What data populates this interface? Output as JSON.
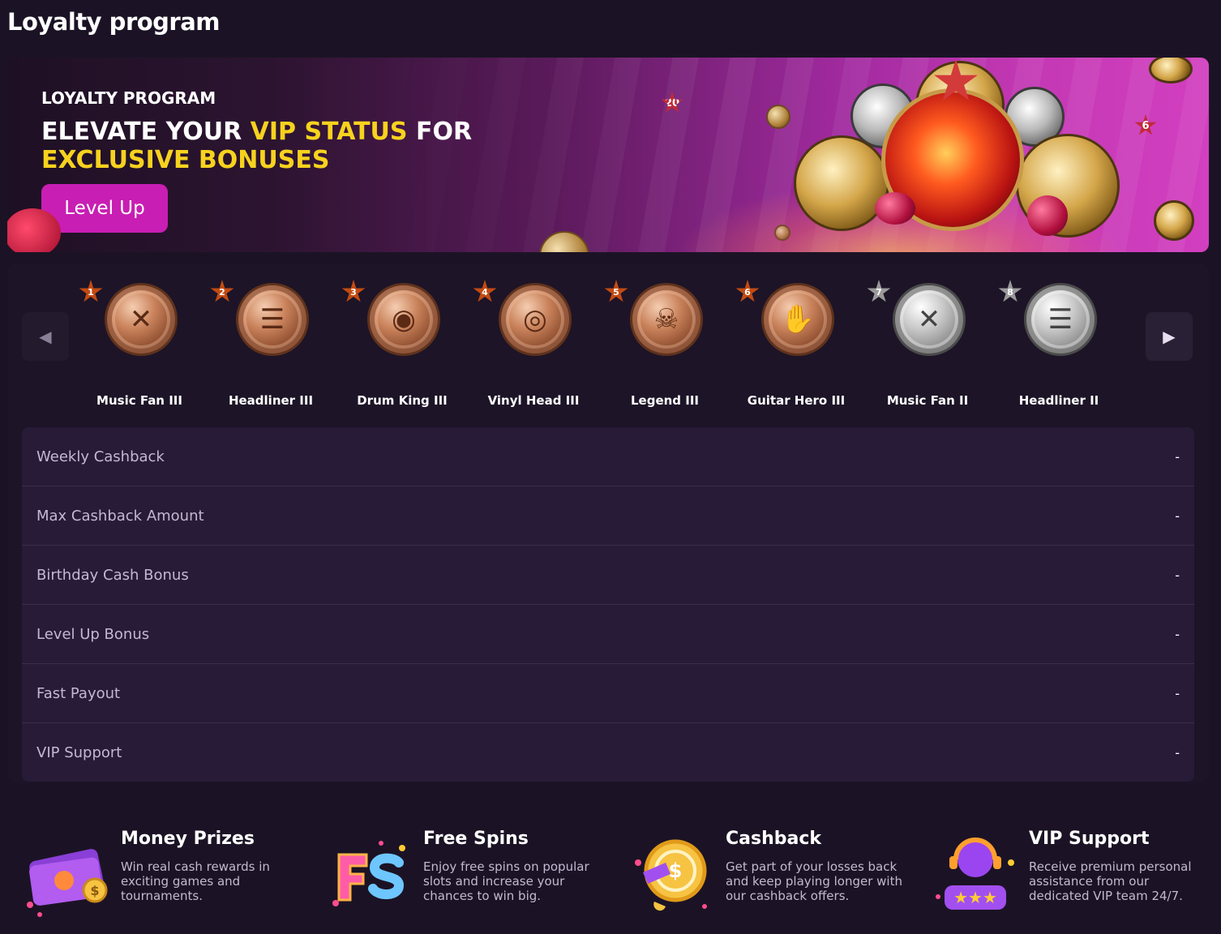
{
  "page": {
    "title": "Loyalty program"
  },
  "hero": {
    "eyebrow": "LOYALTY PROGRAM",
    "headline_part1": "ELEVATE YOUR ",
    "headline_highlight1": "VIP STATUS",
    "headline_part2": " FOR",
    "headline_highlight2": "EXCLUSIVE BONUSES",
    "cta_label": "Level Up",
    "floating_badges": [
      "20",
      "6"
    ],
    "colors": {
      "accent": "#c81eb3",
      "highlight": "#f7d21e"
    }
  },
  "levels": [
    {
      "number": "1",
      "name": "Music Fan III",
      "tier": "bronze",
      "icon": "crossed-drumsticks-icon"
    },
    {
      "number": "2",
      "name": "Headliner III",
      "tier": "bronze",
      "icon": "microphone-icon"
    },
    {
      "number": "3",
      "name": "Drum King III",
      "tier": "bronze",
      "icon": "drum-kit-icon"
    },
    {
      "number": "4",
      "name": "Vinyl Head III",
      "tier": "bronze",
      "icon": "vinyl-record-icon"
    },
    {
      "number": "5",
      "name": "Legend III",
      "tier": "bronze",
      "icon": "skull-icon"
    },
    {
      "number": "6",
      "name": "Guitar Hero III",
      "tier": "bronze",
      "icon": "rock-hand-icon"
    },
    {
      "number": "7",
      "name": "Music Fan II",
      "tier": "silver",
      "icon": "crossed-drumsticks-icon"
    },
    {
      "number": "8",
      "name": "Headliner II",
      "tier": "silver",
      "icon": "microphone-icon"
    }
  ],
  "benefits": [
    {
      "label": "Weekly Cashback",
      "value": "-"
    },
    {
      "label": "Max Cashback Amount",
      "value": "-"
    },
    {
      "label": "Birthday Cash Bonus",
      "value": "-"
    },
    {
      "label": "Level Up Bonus",
      "value": "-"
    },
    {
      "label": "Fast Payout",
      "value": "-"
    },
    {
      "label": "VIP Support",
      "value": "-"
    }
  ],
  "features": [
    {
      "title": "Money Prizes",
      "description": "Win real cash rewards in exciting games and tournaments.",
      "icon": "money-bills-icon"
    },
    {
      "title": "Free Spins",
      "description": "Enjoy free spins on popular slots and increase your chances to win big.",
      "icon": "free-spins-icon"
    },
    {
      "title": "Cashback",
      "description": "Get part of your losses back and keep playing longer with our cashback offers.",
      "icon": "cashback-coin-icon"
    },
    {
      "title": "VIP Support",
      "description": "Receive premium personal assistance from our dedicated VIP team 24/7.",
      "icon": "vip-support-agent-icon"
    }
  ]
}
